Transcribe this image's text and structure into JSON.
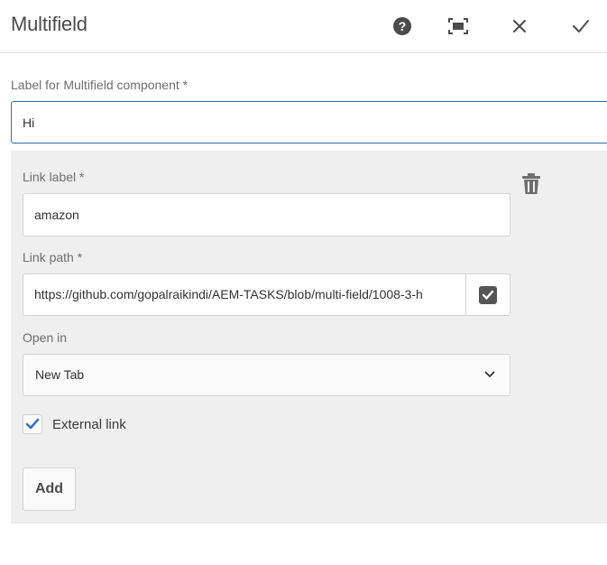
{
  "dialog": {
    "title": "Multifield",
    "header_icons": [
      "help-icon",
      "fullscreen-icon",
      "close-icon",
      "checkmark-icon"
    ]
  },
  "form": {
    "component_label": {
      "label": "Label for Multifield component *",
      "value": "Hi"
    },
    "item": {
      "link_label": {
        "label": "Link label *",
        "value": "amazon"
      },
      "link_path": {
        "label": "Link path *",
        "value": "https://github.com/gopalraikindi/AEM-TASKS/blob/multi-field/1008-3-h"
      },
      "open_in": {
        "label": "Open in",
        "selected": "New Tab"
      },
      "external_link": {
        "label": "External link",
        "checked": true
      },
      "delete_icon": "trash-icon"
    },
    "add_label": "Add"
  },
  "colors": {
    "accent": "#2d6ab8",
    "panel_bg": "#efefef",
    "checkbox_blue": "#2c73d2",
    "icon_gray": "#6e6e6e"
  }
}
